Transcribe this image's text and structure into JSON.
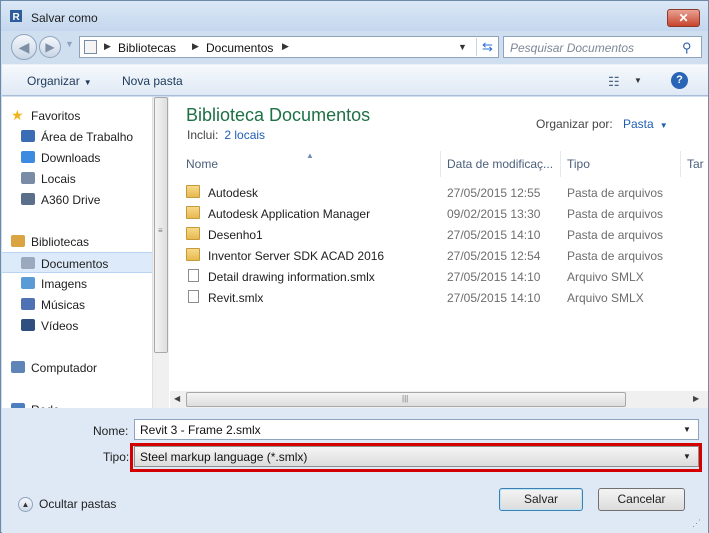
{
  "window": {
    "title": "Salvar como",
    "close_label": "✕"
  },
  "nav": {
    "breadcrumb": [
      "Bibliotecas",
      "Documentos"
    ],
    "search_placeholder": "Pesquisar Documentos"
  },
  "toolbar": {
    "organize": "Organizar",
    "new_folder": "Nova pasta"
  },
  "sidebar": {
    "items": [
      {
        "label": "Favoritos",
        "icon": "star-icon"
      },
      {
        "label": "Área de Trabalho",
        "icon": "desktop-icon"
      },
      {
        "label": "Downloads",
        "icon": "downloads-icon"
      },
      {
        "label": "Locais",
        "icon": "recent-places-icon"
      },
      {
        "label": "A360 Drive",
        "icon": "cloud-drive-icon"
      },
      {
        "label": "Bibliotecas",
        "icon": "libraries-icon"
      },
      {
        "label": "Documentos",
        "icon": "documents-icon",
        "selected": true
      },
      {
        "label": "Imagens",
        "icon": "pictures-icon"
      },
      {
        "label": "Músicas",
        "icon": "music-icon"
      },
      {
        "label": "Vídeos",
        "icon": "videos-icon"
      },
      {
        "label": "Computador",
        "icon": "computer-icon"
      },
      {
        "label": "Rede",
        "icon": "network-icon"
      }
    ]
  },
  "library": {
    "title": "Biblioteca Documentos",
    "includes_label": "Inclui:",
    "includes_link": "2 locais",
    "arrange_label": "Organizar por:",
    "arrange_value": "Pasta"
  },
  "columns": {
    "name": "Nome",
    "date": "Data de modificaç...",
    "type": "Tipo",
    "size": "Tar"
  },
  "files": [
    {
      "name": "Autodesk",
      "date": "27/05/2015 12:55",
      "type": "Pasta de arquivos",
      "kind": "folder"
    },
    {
      "name": "Autodesk Application Manager",
      "date": "09/02/2015 13:30",
      "type": "Pasta de arquivos",
      "kind": "folder"
    },
    {
      "name": "Desenho1",
      "date": "27/05/2015 14:10",
      "type": "Pasta de arquivos",
      "kind": "folder"
    },
    {
      "name": "Inventor Server SDK ACAD 2016",
      "date": "27/05/2015 12:54",
      "type": "Pasta de arquivos",
      "kind": "folder"
    },
    {
      "name": "Detail drawing information.smlx",
      "date": "27/05/2015 14:10",
      "type": "Arquivo SMLX",
      "kind": "file"
    },
    {
      "name": "Revit.smlx",
      "date": "27/05/2015 14:10",
      "type": "Arquivo SMLX",
      "kind": "file"
    }
  ],
  "form": {
    "name_label": "Nome:",
    "name_value": "Revit 3 - Frame 2.smlx",
    "type_label": "Tipo:",
    "type_value": "Steel markup language (*.smlx)",
    "hide_folders": "Ocultar pastas",
    "save": "Salvar",
    "cancel": "Cancelar"
  },
  "colors": {
    "library_title": "#1e7145",
    "link": "#1f5fb3",
    "highlight": "#d40000"
  }
}
